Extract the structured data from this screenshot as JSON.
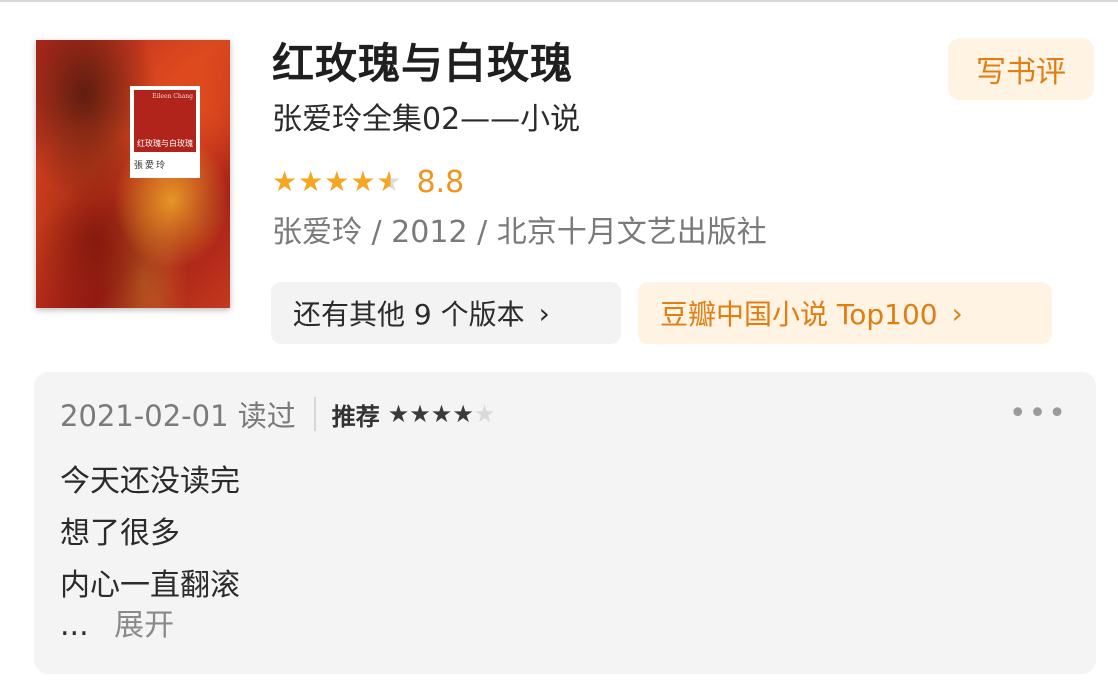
{
  "book": {
    "title": "红玫瑰与白玫瑰",
    "subtitle": "张爱玲全集02——小说",
    "rating": {
      "stars": 4.5,
      "score": "8.8"
    },
    "meta": "张爱玲 / 2012 / 北京十月文艺出版社",
    "cover": {
      "author_en": "Eileen Chang",
      "title": "红玫瑰与白玫瑰",
      "signature": "張愛玲"
    }
  },
  "actions": {
    "write_review": "写书评",
    "versions": "还有其他 9 个版本",
    "top_list": "豆瓣中国小说 Top100"
  },
  "review": {
    "date_read": "2021-02-01 读过",
    "recommend_label": "推荐",
    "stars": 4,
    "lines": [
      "今天还没读完",
      "想了很多",
      "内心一直翻滚"
    ],
    "ellipsis": "...",
    "expand": "展开"
  },
  "icons": {
    "chevron": "chevron-right-icon",
    "more": "more-dots-icon"
  },
  "colors": {
    "accent": "#f0951e",
    "chip_bg": "#fff3e3",
    "card_bg": "#f4f4f4"
  }
}
